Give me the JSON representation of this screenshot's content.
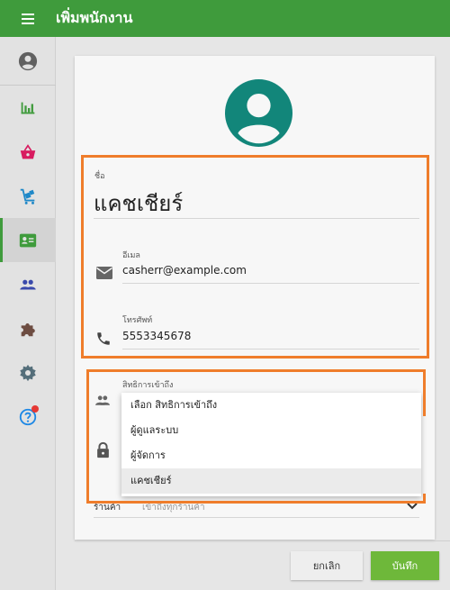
{
  "header": {
    "title": "เพิ่มพนักงาน"
  },
  "sidebar": {
    "items": [
      {
        "name": "account-icon"
      },
      {
        "name": "chart-icon"
      },
      {
        "name": "basket-icon"
      },
      {
        "name": "cart-icon"
      },
      {
        "name": "badge-icon",
        "active": true
      },
      {
        "name": "people-icon"
      },
      {
        "name": "puzzle-icon"
      },
      {
        "name": "gear-icon"
      },
      {
        "name": "help-icon",
        "notification": true
      }
    ]
  },
  "form": {
    "name_label": "ชื่อ",
    "name_value": "แคชเชียร์",
    "email_label": "อีเมล",
    "email_value": "casherr@example.com",
    "phone_label": "โทรศัพท์",
    "phone_value": "5553345678",
    "role_label": "สิทธิการเข้าถึง",
    "store_label": "ร้านค้า",
    "store_value": "เข้าถึงทุกร้านค้า"
  },
  "role_dropdown": {
    "options": [
      "เลือก สิทธิการเข้าถึง",
      "ผู้ดูแลระบบ",
      "ผู้จัดการ",
      "แคชเชียร์"
    ],
    "selected": "แคชเชียร์"
  },
  "buttons": {
    "cancel": "ยกเลิก",
    "save": "บันทึก"
  },
  "colors": {
    "primary": "#3f9b3c",
    "avatar": "#12867a",
    "highlight": "#ef7d2b",
    "save": "#6eb83a"
  }
}
